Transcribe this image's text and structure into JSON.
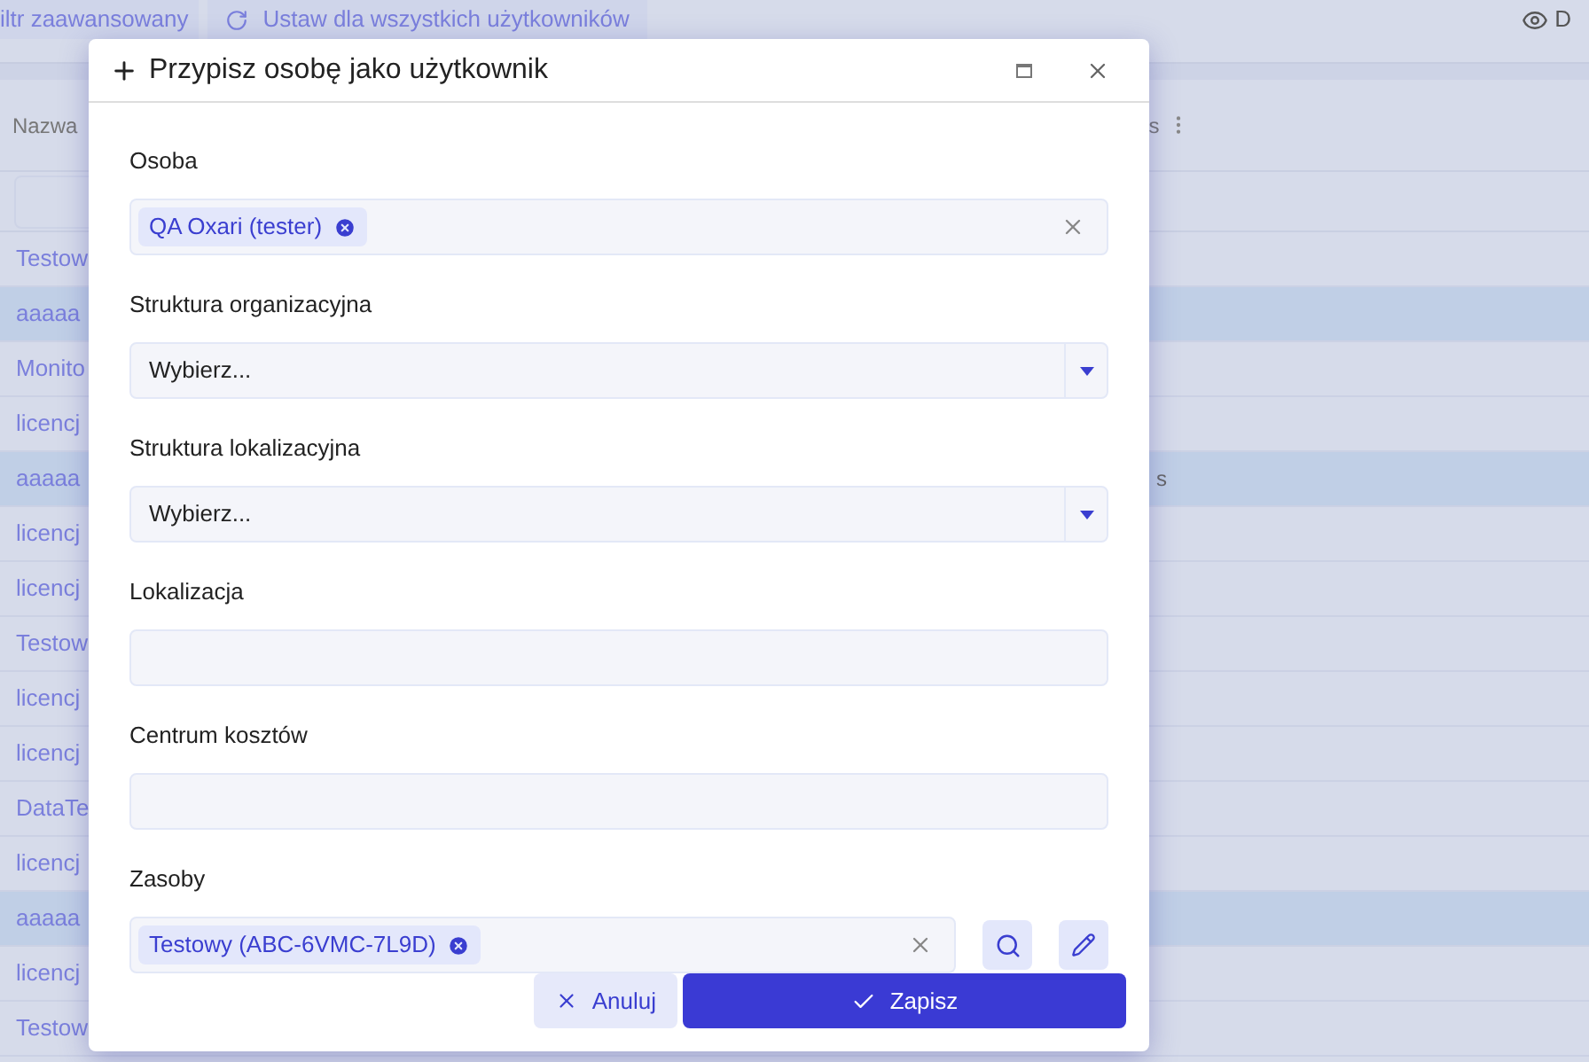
{
  "toolbar": {
    "buttons": [
      {
        "label": "iltr zaawansowany",
        "kind": "plain"
      },
      {
        "label": "Ustaw dla wszystkich użytkowników",
        "kind": "refresh"
      }
    ],
    "view_button": "D"
  },
  "table": {
    "columns": [
      "Nazwa",
      "s"
    ],
    "rows": [
      {
        "name": "Testow",
        "selected": false
      },
      {
        "name": "aaaaa",
        "selected": true
      },
      {
        "name": "Monito",
        "selected": false
      },
      {
        "name": "licencj",
        "selected": false
      },
      {
        "name": "aaaaa",
        "selected": true,
        "column_2": "s"
      },
      {
        "name": "licencj",
        "selected": false
      },
      {
        "name": "licencj",
        "selected": false
      },
      {
        "name": "Testow",
        "selected": false
      },
      {
        "name": "licencj",
        "selected": false
      },
      {
        "name": "licencj",
        "selected": false
      },
      {
        "name": "DataTe",
        "selected": false
      },
      {
        "name": "licencj",
        "selected": false
      },
      {
        "name": "aaaaa",
        "selected": true
      },
      {
        "name": "licencj",
        "selected": false
      },
      {
        "name": "Testow",
        "selected": false
      }
    ]
  },
  "dialog": {
    "title": "Przypisz osobę jako użytkownik",
    "fields": [
      {
        "label": "Osoba",
        "kind": "tags",
        "tags": [
          "QA Oxari (tester)"
        ]
      },
      {
        "label": "Struktura organizacyjna",
        "kind": "select",
        "value": "Wybierz..."
      },
      {
        "label": "Struktura lokalizacyjna",
        "kind": "select",
        "value": "Wybierz..."
      },
      {
        "label": "Lokalizacja",
        "kind": "text"
      },
      {
        "label": "Centrum kosztów",
        "kind": "text"
      },
      {
        "label": "Zasoby",
        "kind": "tags",
        "tags": [
          "Testowy (ABC-6VMC-7L9D)"
        ],
        "actions": true
      }
    ],
    "cancel": "Anuluj",
    "save": "Zapisz"
  }
}
